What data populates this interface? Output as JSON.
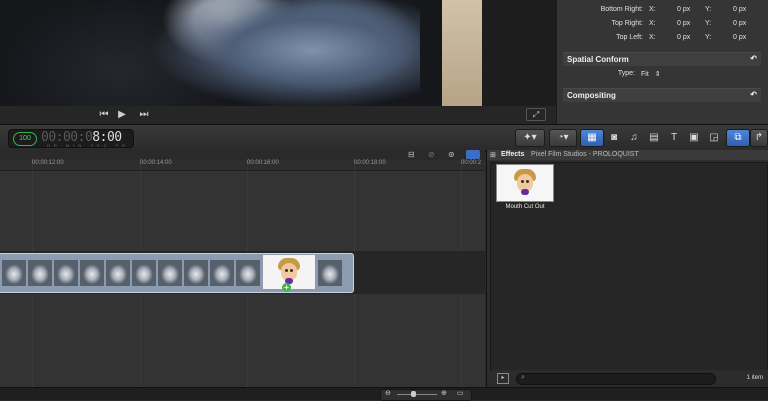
{
  "inspector": {
    "rows": [
      {
        "label": "Bottom Right:",
        "x_label": "X:",
        "x_value": "0 px",
        "y_label": "Y:",
        "y_value": "0 px"
      },
      {
        "label": "Top Right:",
        "x_label": "X:",
        "x_value": "0 px",
        "y_label": "Y:",
        "y_value": "0 px"
      },
      {
        "label": "Top Left:",
        "x_label": "X:",
        "x_value": "0 px",
        "y_label": "Y:",
        "y_value": "0 px"
      }
    ],
    "spatial_conform": {
      "title": "Spatial Conform",
      "type_label": "Type:",
      "type_value": "Fit"
    },
    "compositing": {
      "title": "Compositing"
    }
  },
  "toolbar": {
    "percent": "100",
    "timecode_dim": "00:00:0",
    "timecode_lit": "8:00",
    "timecode_units": "HR MIN SEC FR"
  },
  "timeline": {
    "ticks": [
      "00:00:12:00",
      "00:00:14:00",
      "00:00:16:00",
      "00:00:18:00",
      "00:00:2"
    ]
  },
  "effects": {
    "header_title": "Effects",
    "header_path": "Pixel Film Studios - PROLOQUIST",
    "item_label": "Mouth Cut Out",
    "count": "1 item"
  },
  "icons": {
    "reset": "reset-arrow-icon",
    "stepper": "stepper-icon",
    "magic": "magic-wand-icon",
    "retime": "retime-icon",
    "search": "search-icon",
    "add": "add-plus-icon"
  },
  "colors": {
    "accent": "#3c6fc4",
    "clip": "#8c9bb0",
    "timecode_green": "#4ad05d"
  }
}
